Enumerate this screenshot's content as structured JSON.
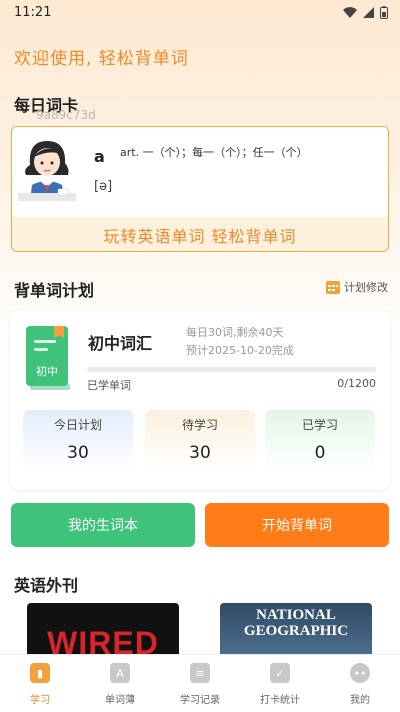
{
  "status_bar": {
    "time": "11:21"
  },
  "welcome": "欢迎使用, 轻松背单词",
  "daily_card": {
    "title": "每日词卡",
    "card_id": "9a89c73d",
    "word": "a",
    "meaning": "art. 一（个）；每一（个）；任一（个）",
    "phonetic": "[ə]",
    "banner": "玩转英语单词  轻松背单词"
  },
  "plan": {
    "title": "背单词计划",
    "edit_label": "计划修改",
    "book_label": "初中",
    "name": "初中词汇",
    "daily_info": "每日30词,剩余40天",
    "finish_info": "预计2025-10-20完成",
    "learned_label": "已学单词",
    "learned_count": "0/1200",
    "progress_fraction": 0,
    "stats": [
      {
        "label": "今日计划",
        "value": "30"
      },
      {
        "label": "待学习",
        "value": "30"
      },
      {
        "label": "已学习",
        "value": "0"
      }
    ]
  },
  "buttons": {
    "vocab_book": "我的生词本",
    "start": "开始背单词"
  },
  "magazines": {
    "title": "英语外刊",
    "items": [
      "WIRED",
      "NATIONAL GEOGRAPHIC"
    ]
  },
  "tabs": [
    {
      "label": "学习",
      "icon": "book-icon"
    },
    {
      "label": "单词薄",
      "icon": "wordbook-icon"
    },
    {
      "label": "学习记录",
      "icon": "record-icon"
    },
    {
      "label": "打卡统计",
      "icon": "checkin-icon"
    },
    {
      "label": "我的",
      "icon": "profile-icon"
    }
  ],
  "colors": {
    "accent": "#f08a2a",
    "green": "#3fc27a",
    "orange": "#ff7c16"
  }
}
